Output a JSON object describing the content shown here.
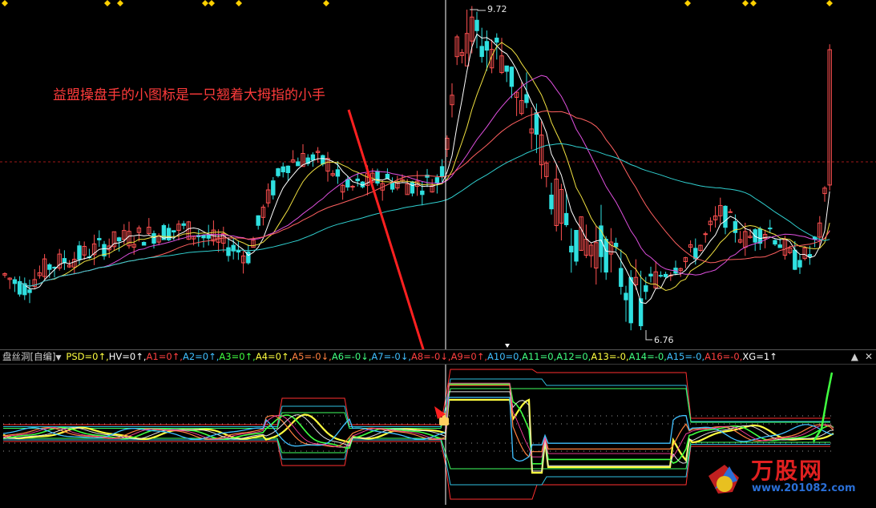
{
  "annotation": "益盟操盘手的小图标是一只翘着大拇指的小手",
  "price_high_label": "9.72",
  "price_low_label": "6.76",
  "indicator": {
    "name": "盘丝洞[自编]",
    "values": [
      {
        "text": "PSD=0↑",
        "color": "#ffff40"
      },
      {
        "text": "HV=0↑",
        "color": "#ffffff"
      },
      {
        "text": "A1=0↑",
        "color": "#ff4040"
      },
      {
        "text": "A2=0↑",
        "color": "#40c0ff"
      },
      {
        "text": "A3=0↑",
        "color": "#40ff40"
      },
      {
        "text": "A4=0↑",
        "color": "#ffff40"
      },
      {
        "text": "A5=-0↓",
        "color": "#ff8040"
      },
      {
        "text": "A6=-0↓",
        "color": "#40ff80"
      },
      {
        "text": "A7=-0↓",
        "color": "#40c0ff"
      },
      {
        "text": "A8=-0↓",
        "color": "#ff4040"
      },
      {
        "text": "A9=0↑",
        "color": "#ff4040"
      },
      {
        "text": "A10=0",
        "color": "#40c0ff"
      },
      {
        "text": "A11=0",
        "color": "#40ff80"
      },
      {
        "text": "A12=0",
        "color": "#40ff80"
      },
      {
        "text": "A13=-0",
        "color": "#ffff40"
      },
      {
        "text": "A14=-0",
        "color": "#40ff80"
      },
      {
        "text": "A15=-0",
        "color": "#40c0ff"
      },
      {
        "text": "A16=-0",
        "color": "#ff4040"
      },
      {
        "text": "XG=1↑",
        "color": "#ffffff"
      }
    ]
  },
  "window_buttons": {
    "up": "▲",
    "close": "✕"
  },
  "watermark": {
    "brand": "万股网",
    "url": "www.201082.com"
  },
  "colors": {
    "up": "#ff5050",
    "down": "#2fe0e0",
    "ma5": "#ffffff",
    "ma10": "#f0e040",
    "ma20": "#e050e0",
    "ma30": "#ff6060",
    "ma60": "#30d0d0",
    "crosshair": "#ffffff"
  }
}
